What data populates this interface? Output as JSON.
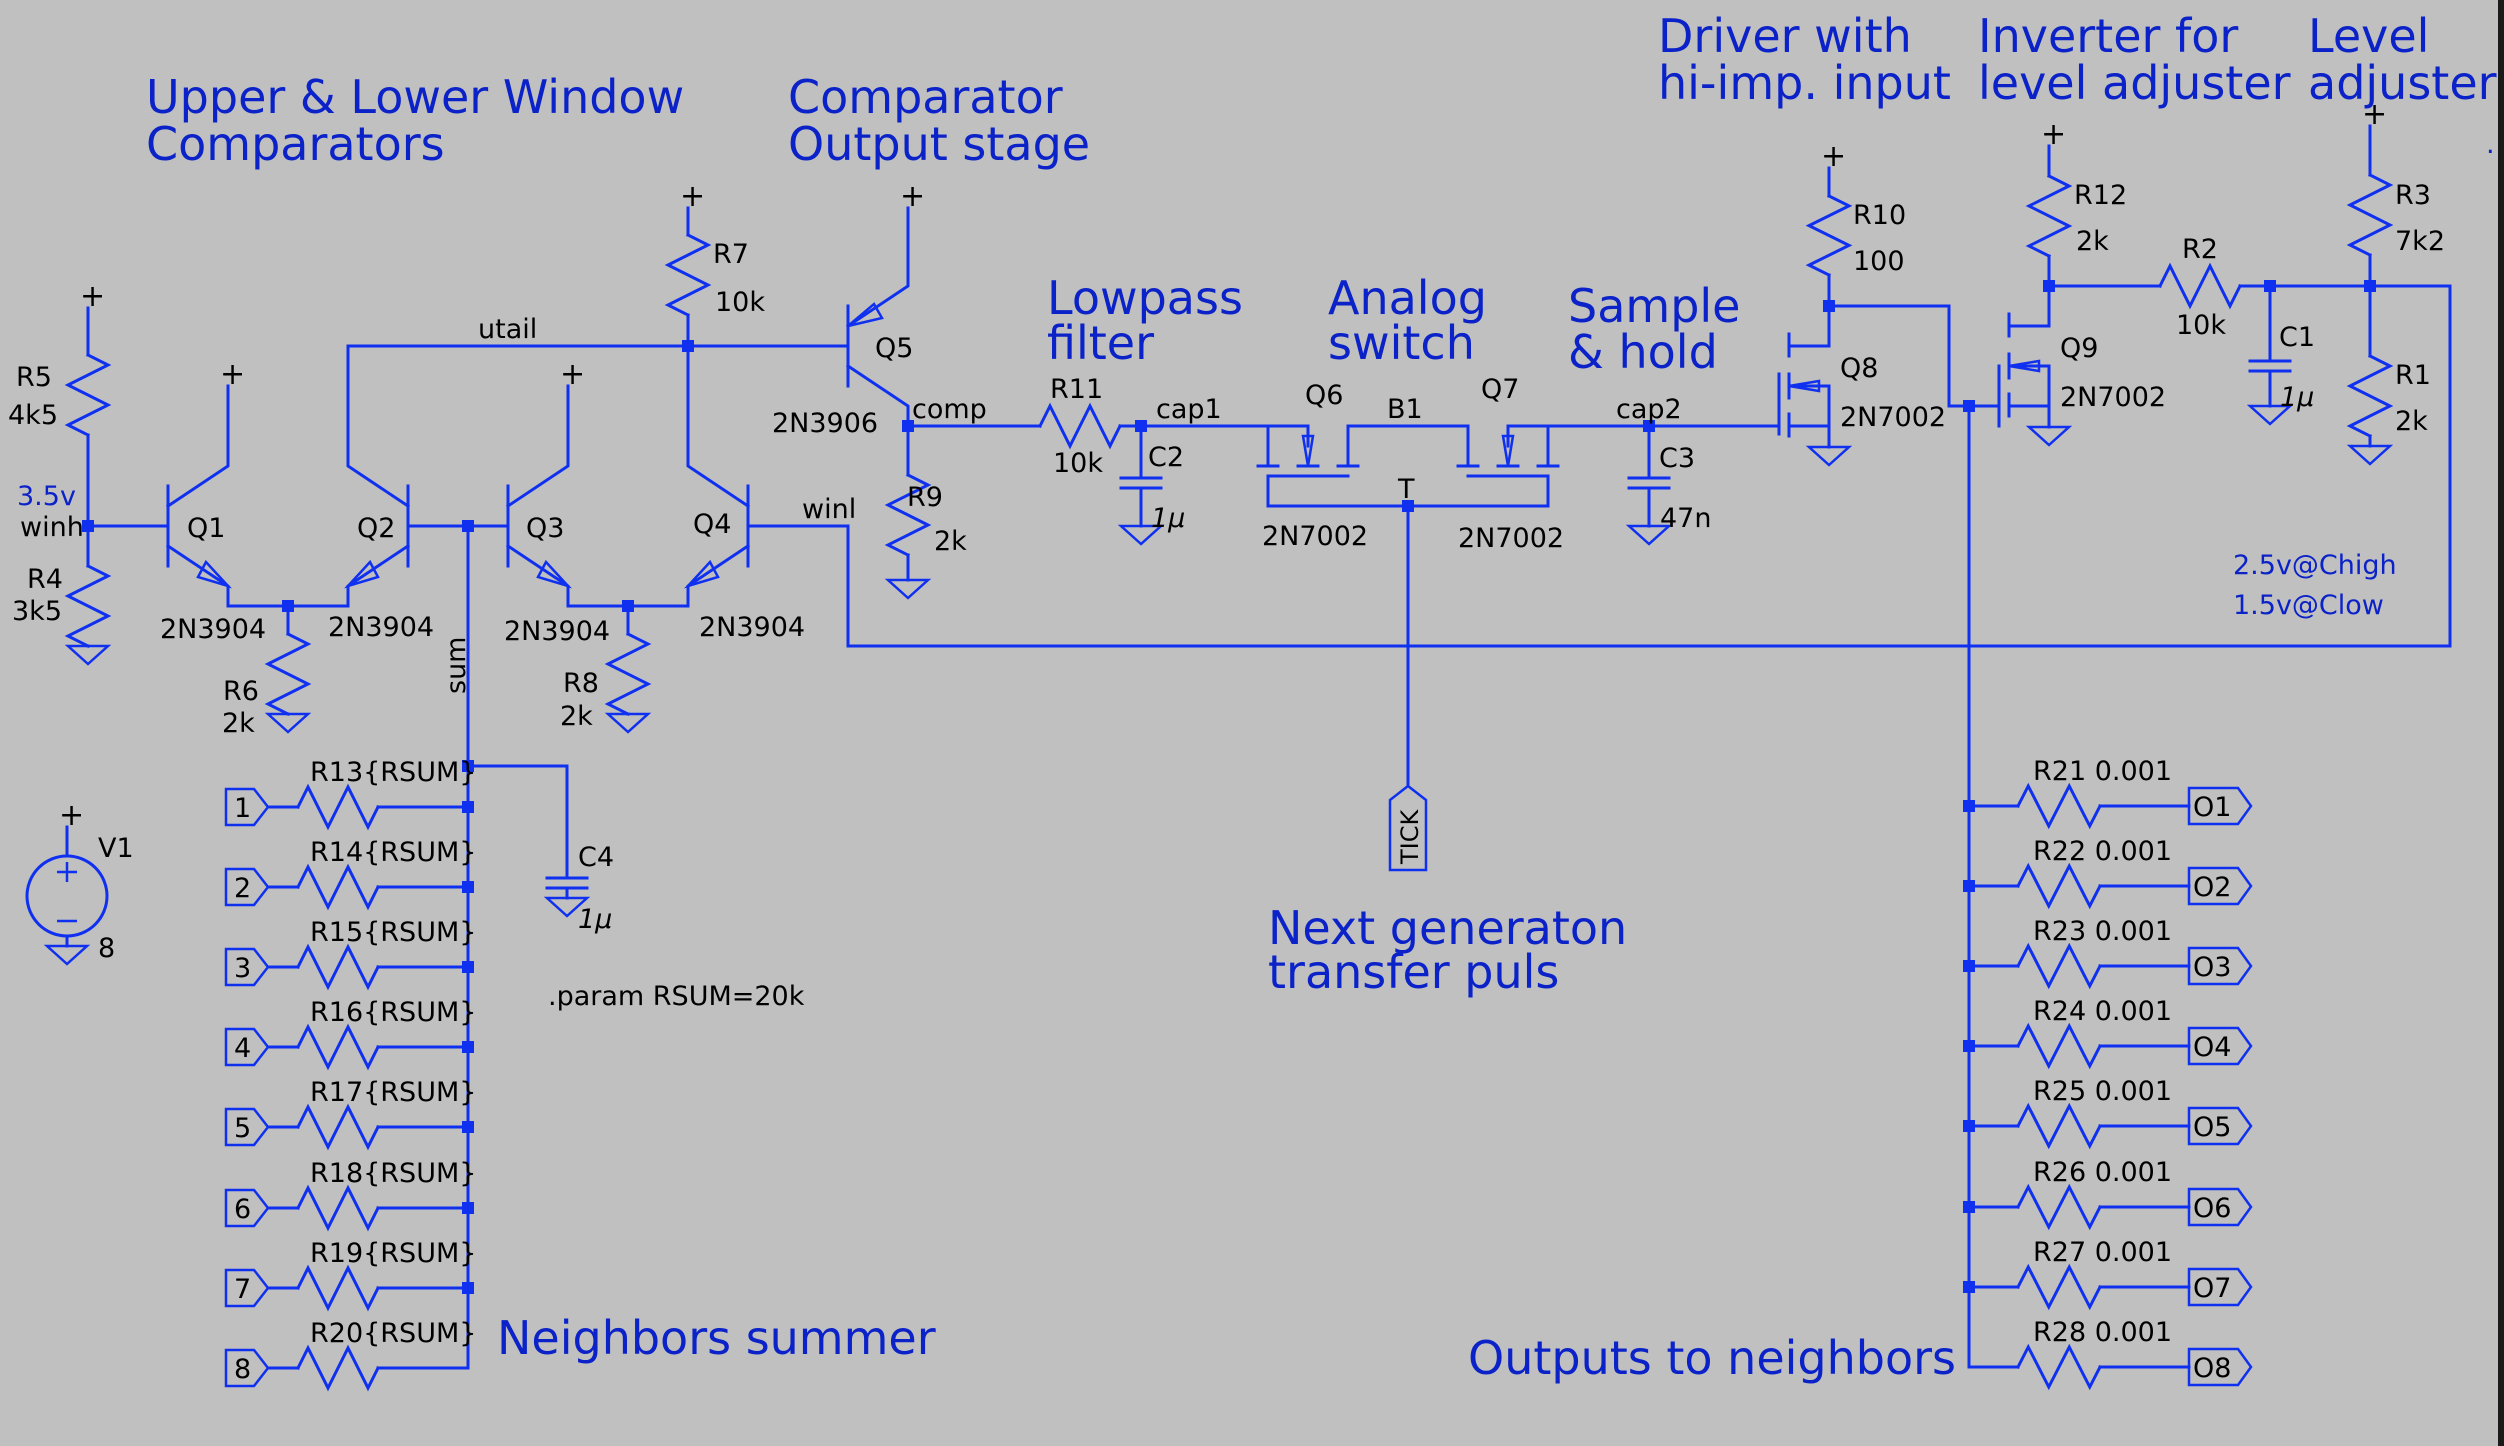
{
  "titles": {
    "window_comparators": [
      "Upper & Lower Window",
      "Comparators"
    ],
    "output_stage": [
      "Comparator",
      "Output stage"
    ],
    "lowpass": [
      "Lowpass",
      "filter"
    ],
    "analog_switch": [
      "Analog",
      "switch"
    ],
    "sample_hold": [
      "Sample",
      "& hold"
    ],
    "driver": [
      "Driver with",
      "hi-imp. input"
    ],
    "inverter": [
      "Inverter for",
      "level adjuster"
    ],
    "level_adjuster": [
      "Level",
      "adjuster"
    ],
    "next_gen": [
      "Next generaton",
      "transfer puls"
    ],
    "neighbors_summer": "Neighbors summer",
    "outputs_to_neighbors": "Outputs to neighbors"
  },
  "annotations": {
    "winh_voltage": "3.5v",
    "level_high": "2.5v@Chigh",
    "level_low": "1.5v@Clow",
    "param_directive": ".param RSUM=20k",
    "supply_symbol": "+"
  },
  "nets": {
    "utail": "utail",
    "winh": "winh",
    "winl": "winl",
    "sum": "sum",
    "comp": "comp",
    "cap1": "cap1",
    "cap2": "cap2",
    "b1": "B1",
    "t": "T",
    "tick": "TICK"
  },
  "components": {
    "R5": {
      "name": "R5",
      "value": "4k5"
    },
    "R4": {
      "name": "R4",
      "value": "3k5"
    },
    "R6": {
      "name": "R6",
      "value": "2k"
    },
    "R7": {
      "name": "R7",
      "value": "10k"
    },
    "R8": {
      "name": "R8",
      "value": "2k"
    },
    "R9": {
      "name": "R9",
      "value": "2k"
    },
    "R11": {
      "name": "R11",
      "value": "10k"
    },
    "R10": {
      "name": "R10",
      "value": "100"
    },
    "R12": {
      "name": "R12",
      "value": "2k"
    },
    "R2": {
      "name": "R2",
      "value": "10k"
    },
    "R3": {
      "name": "R3",
      "value": "7k2"
    },
    "R1": {
      "name": "R1",
      "value": "2k"
    },
    "C1": {
      "name": "C1",
      "value": "1μ"
    },
    "C2": {
      "name": "C2",
      "value": "1μ"
    },
    "C3": {
      "name": "C3",
      "value": "47n"
    },
    "C4": {
      "name": "C4",
      "value": "1μ"
    },
    "Q1": {
      "name": "Q1",
      "model": "2N3904"
    },
    "Q2": {
      "name": "Q2",
      "model": "2N3904"
    },
    "Q3": {
      "name": "Q3",
      "model": "2N3904"
    },
    "Q4": {
      "name": "Q4",
      "model": "2N3904"
    },
    "Q5": {
      "name": "Q5",
      "model": "2N3906"
    },
    "Q6": {
      "name": "Q6",
      "model": "2N7002"
    },
    "Q7": {
      "name": "Q7",
      "model": "2N7002"
    },
    "Q8": {
      "name": "Q8",
      "model": "2N7002"
    },
    "Q9": {
      "name": "Q9",
      "model": "2N7002"
    },
    "V1": {
      "name": "V1",
      "value": "8"
    }
  },
  "summer_inputs": [
    {
      "port": "1",
      "resistor": "R13",
      "value": "{RSUM}"
    },
    {
      "port": "2",
      "resistor": "R14",
      "value": "{RSUM}"
    },
    {
      "port": "3",
      "resistor": "R15",
      "value": "{RSUM}"
    },
    {
      "port": "4",
      "resistor": "R16",
      "value": "{RSUM}"
    },
    {
      "port": "5",
      "resistor": "R17",
      "value": "{RSUM}"
    },
    {
      "port": "6",
      "resistor": "R18",
      "value": "{RSUM}"
    },
    {
      "port": "7",
      "resistor": "R19",
      "value": "{RSUM}"
    },
    {
      "port": "8",
      "resistor": "R20",
      "value": "{RSUM}"
    }
  ],
  "neighbor_outputs": [
    {
      "port": "O1",
      "resistor": "R21",
      "value": "0.001"
    },
    {
      "port": "O2",
      "resistor": "R22",
      "value": "0.001"
    },
    {
      "port": "O3",
      "resistor": "R23",
      "value": "0.001"
    },
    {
      "port": "O4",
      "resistor": "R24",
      "value": "0.001"
    },
    {
      "port": "O5",
      "resistor": "R25",
      "value": "0.001"
    },
    {
      "port": "O6",
      "resistor": "R26",
      "value": "0.001"
    },
    {
      "port": "O7",
      "resistor": "R27",
      "value": "0.001"
    },
    {
      "port": "O8",
      "resistor": "R28",
      "value": "0.001"
    }
  ],
  "colors": {
    "background": "#c0c0c0",
    "wire": "#1030f0",
    "comment_text": "#0a22c8",
    "label_text": "#000000"
  }
}
